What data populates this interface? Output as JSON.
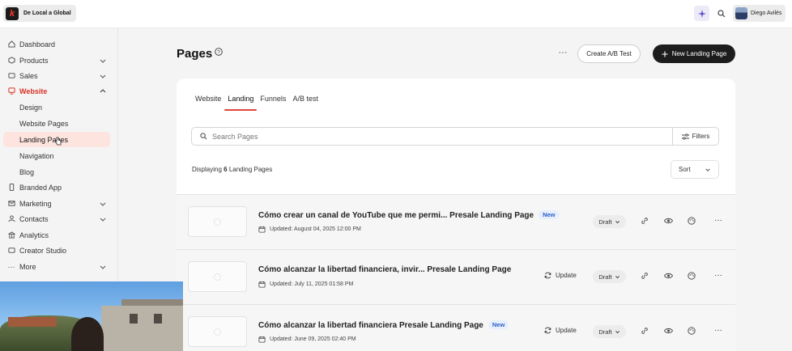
{
  "topbar": {
    "brand_name": "De Local a Global",
    "user_name": "Diego Avilés"
  },
  "sidebar": {
    "items": [
      {
        "label": "Dashboard"
      },
      {
        "label": "Products"
      },
      {
        "label": "Sales"
      },
      {
        "label": "Website"
      },
      {
        "label": "Design"
      },
      {
        "label": "Website Pages"
      },
      {
        "label": "Landing Pages"
      },
      {
        "label": "Navigation"
      },
      {
        "label": "Blog"
      },
      {
        "label": "Branded App"
      },
      {
        "label": "Marketing"
      },
      {
        "label": "Contacts"
      },
      {
        "label": "Analytics"
      },
      {
        "label": "Creator Studio"
      },
      {
        "label": "More"
      }
    ]
  },
  "header": {
    "title": "Pages",
    "more_label": "···",
    "create_ab_label": "Create A/B Test",
    "new_landing_label": "New Landing Page"
  },
  "tabs": [
    {
      "label": "Website"
    },
    {
      "label": "Landing"
    },
    {
      "label": "Funnels"
    },
    {
      "label": "A/B test"
    }
  ],
  "search": {
    "placeholder": "Search Pages",
    "filters_label": "Filters"
  },
  "summary": {
    "prefix": "Displaying",
    "count": "6",
    "suffix": "Landing Pages",
    "sort_label": "Sort"
  },
  "rows": [
    {
      "title": "Cómo crear un canal de YouTube que me permi... Presale Landing Page",
      "badge": "New",
      "date": "Updated: August 04, 2025 12:00 PM",
      "update_label": "",
      "status": "Draft"
    },
    {
      "title": "Cómo alcanzar la libertad financiera, invir... Presale Landing Page",
      "badge": "",
      "date": "Updated: July 11, 2025 01:58 PM",
      "update_label": "Update",
      "status": "Draft"
    },
    {
      "title": "Cómo alcanzar la libertad financiera Presale Landing Page",
      "badge": "New",
      "date": "Updated: June 09, 2025 02:40 PM",
      "update_label": "Update",
      "status": "Draft"
    }
  ],
  "colors": {
    "accent": "#e0453a",
    "selected_bg": "#fde4df",
    "badge_blue": "#2c5fc4"
  }
}
